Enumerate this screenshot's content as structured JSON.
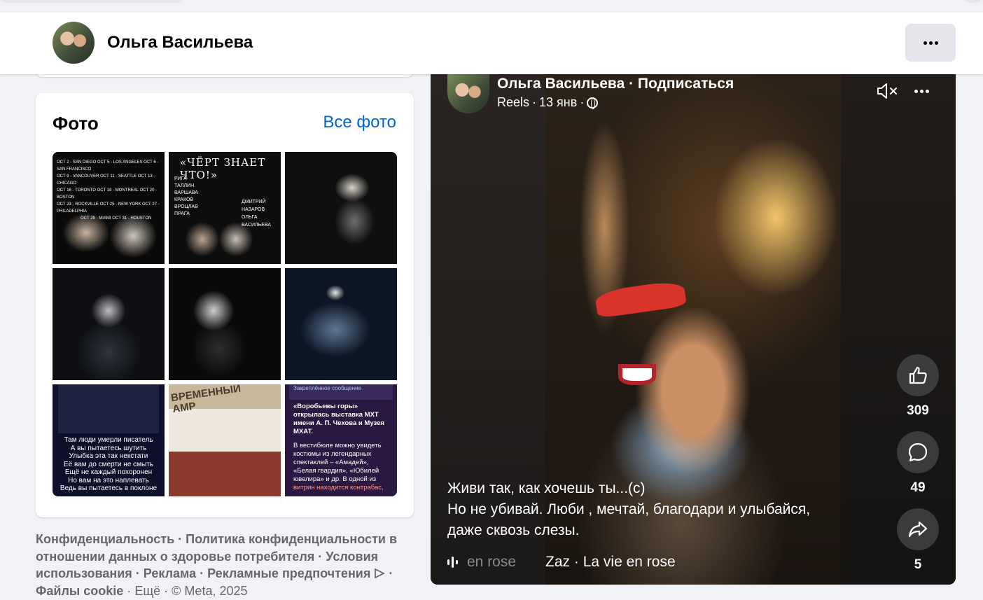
{
  "profile": {
    "name": "Ольга Васильева"
  },
  "photos": {
    "title": "Фото",
    "all_link": "Все фото",
    "tiles": [
      {
        "lines": [
          "OCT 2 - SAN DIEGO   OCT 5 - LOS ANGELES   OCT 6 - SAN FRANCISCO",
          "OCT 9 - VANCOUVER   OCT 11 - SEATTLE   OCT 13 - CHICAGO",
          "OCT 16 - TORONTO   OCT 18 - MONTREAL   OCT 20 - BOSTON",
          "OCT 23 - ROCKVILLE   OCT 25 - NEW YORK   OCT 27 - PHILADELPHIA",
          "OCT 29 - MIAMI   OCT 31 - HOUSTON"
        ]
      },
      {
        "title": "«ЧЁРТ ЗНАЕТ ЧТО!»",
        "cities": [
          "РИГА",
          "ТАЛЛИН",
          "ВАРШАВА",
          "КРАКОВ",
          "ВРОЦЛАВ",
          "ПРАГА"
        ],
        "names": [
          "ДМИТРИЙ НАЗАРОВ",
          "ОЛЬГА ВАСИЛЬЕВА"
        ]
      },
      {},
      {},
      {},
      {},
      {
        "lines": [
          "Там люди умерли писатель",
          "А вы пытаетесь шутить",
          "Улыбка эта так некстати",
          "Её вам до смерти не смыть",
          "Ещё не каждый похоронен",
          "Но вам на это наплевать",
          "Ведь вы пытаетесь в поклоне"
        ]
      },
      {
        "sign": "ВРЕМЕННЫЙ АМР"
      },
      {
        "pinned": "Закреплённое сообщение",
        "lines": [
          "«Воробьевы горы»",
          "открылась выставка МХТ",
          "имени А. П. Чехова и Музея",
          "МХАТ.",
          "",
          "В вестибюле можно увидеть",
          "костюмы из легендарных",
          "спектаклей – «Амадей»,",
          "«Белая гвардия», «Юбилей",
          "ювелира» и др. В одной из",
          "витрин находится контрабас,"
        ]
      }
    ]
  },
  "footer": {
    "links": [
      "Конфиденциальность",
      "Политика конфиденциальности в отношении данных о здоровье потребителя",
      "Условия использования",
      "Реклама",
      "Рекламные предпочтения"
    ],
    "cookie": "Файлы cookie",
    "more": "Ещё",
    "copyright": "© Meta, 2025"
  },
  "reel": {
    "author": "Ольга Васильева",
    "follow": "Подписаться",
    "type": "Reels",
    "date": "13 янв",
    "caption": [
      "Живи так, как хочешь ты...(с)",
      "Но не убивай.  Люби , мечтай, благодари и улыбайся,",
      "даже сквозь слезы."
    ],
    "music_faded": "en rose",
    "music": "Zaz · La vie en rose",
    "likes": "309",
    "comments": "49",
    "shares": "5"
  },
  "colors": {
    "link": "#0064d1",
    "page_bg": "#f0f2f5",
    "secondary_text": "#65676b"
  }
}
